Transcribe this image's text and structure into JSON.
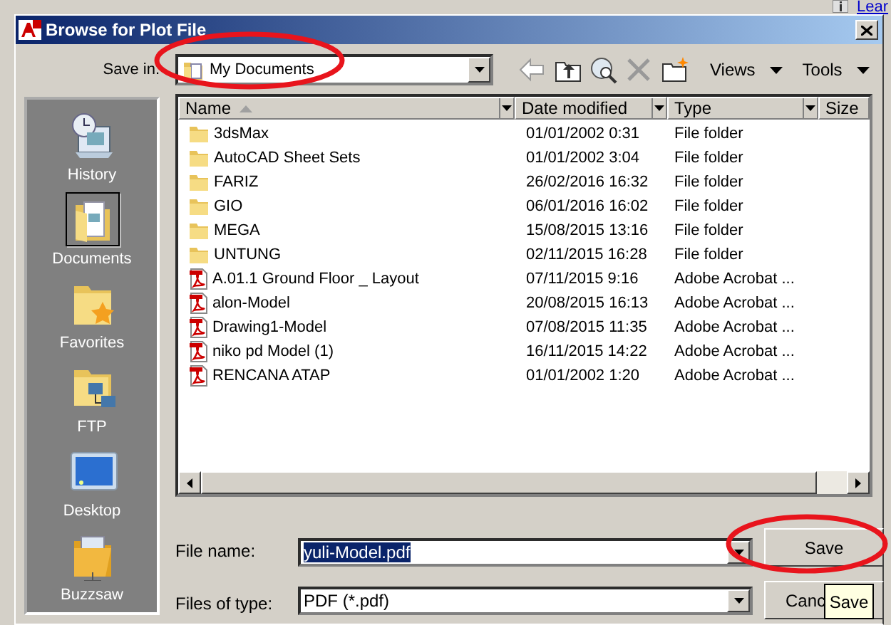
{
  "background": {
    "link": "Lear"
  },
  "window": {
    "title": "Browse for Plot File"
  },
  "save_in": {
    "label": "Save in:",
    "value": "My Documents"
  },
  "toolbar": {
    "views": "Views",
    "tools": "Tools"
  },
  "places": [
    {
      "kind": "history",
      "label": "History",
      "selected": false
    },
    {
      "kind": "documents",
      "label": "Documents",
      "selected": true
    },
    {
      "kind": "favorites",
      "label": "Favorites",
      "selected": false
    },
    {
      "kind": "ftp",
      "label": "FTP",
      "selected": false
    },
    {
      "kind": "desktop",
      "label": "Desktop",
      "selected": false
    },
    {
      "kind": "buzzsaw",
      "label": "Buzzsaw",
      "selected": false
    }
  ],
  "columns": [
    {
      "label": "Name",
      "sorted": true
    },
    {
      "label": "Date modified",
      "sorted": false
    },
    {
      "label": "Type",
      "sorted": false
    },
    {
      "label": "Size",
      "sorted": false
    }
  ],
  "rows": [
    {
      "kind": "folder",
      "name": "3dsMax",
      "date": "01/01/2002 0:31",
      "type": "File folder"
    },
    {
      "kind": "folder",
      "name": "AutoCAD Sheet Sets",
      "date": "01/01/2002 3:04",
      "type": "File folder"
    },
    {
      "kind": "folder",
      "name": "FARIZ",
      "date": "26/02/2016 16:32",
      "type": "File folder"
    },
    {
      "kind": "folder",
      "name": "GIO",
      "date": "06/01/2016 16:02",
      "type": "File folder"
    },
    {
      "kind": "folder",
      "name": "MEGA",
      "date": "15/08/2015 13:16",
      "type": "File folder"
    },
    {
      "kind": "folder",
      "name": "UNTUNG",
      "date": "02/11/2015 16:28",
      "type": "File folder"
    },
    {
      "kind": "pdf",
      "name": "A.01.1 Ground Floor _ Layout",
      "date": "07/11/2015 9:16",
      "type": "Adobe Acrobat ..."
    },
    {
      "kind": "pdf",
      "name": "alon-Model",
      "date": "20/08/2015 16:13",
      "type": "Adobe Acrobat ..."
    },
    {
      "kind": "pdf",
      "name": "Drawing1-Model",
      "date": "07/08/2015 11:35",
      "type": "Adobe Acrobat ..."
    },
    {
      "kind": "pdf",
      "name": "niko pd Model (1)",
      "date": "16/11/2015 14:22",
      "type": "Adobe Acrobat ..."
    },
    {
      "kind": "pdf",
      "name": "RENCANA ATAP",
      "date": "01/01/2002 1:20",
      "type": "Adobe Acrobat ..."
    }
  ],
  "file_name": {
    "label": "File name:",
    "value": "yuli-Model.pdf",
    "selected": true
  },
  "file_type": {
    "label": "Files of type:",
    "value": "PDF (*.pdf)"
  },
  "buttons": [
    {
      "label": "Save"
    },
    {
      "label": "Canc"
    }
  ],
  "tooltip": "Save",
  "annotations": [
    {
      "kind": "ellipse"
    },
    {
      "kind": "ellipse"
    }
  ]
}
